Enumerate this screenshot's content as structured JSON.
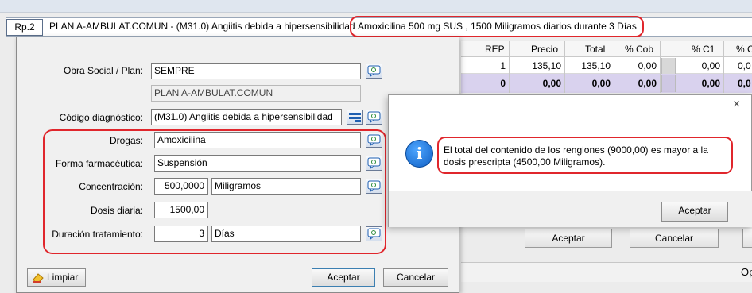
{
  "prescription_bar": {
    "tab": "Rp.2",
    "title": "PLAN A-AMBULAT.COMUN - (M31.0) Angiitis debida a hipersensibilidad",
    "detail": "Amoxicilina 500 mg SUS , 1500 Miligramos diarios durante 3 Días"
  },
  "grid": {
    "headers": [
      "REP",
      "Precio",
      "Total",
      "% Cob",
      "% C1",
      "% C"
    ],
    "rows": [
      [
        "1",
        "135,10",
        "135,10",
        "0,00",
        "0,00",
        "0,0"
      ],
      [
        "0",
        "0,00",
        "0,00",
        "0,00",
        "0,00",
        "0,0"
      ]
    ]
  },
  "form": {
    "obra_social_label": "Obra Social / Plan:",
    "obra_social_value": "SEMPRE",
    "plan_value": "PLAN A-AMBULAT.COMUN",
    "codigo_label": "Código diagnóstico:",
    "codigo_value": "(M31.0) Angiitis debida a hipersensibilidad",
    "drogas_label": "Drogas:",
    "drogas_value": "Amoxicilina",
    "forma_label": "Forma farmacéutica:",
    "forma_value": "Suspensión",
    "concentracion_label": "Concentración:",
    "concentracion_value": "500,0000",
    "concentracion_unit": "Miligramos",
    "dosis_label": "Dosis diaria:",
    "dosis_value": "1500,00",
    "duracion_label": "Duración tratamiento:",
    "duracion_value": "3",
    "duracion_unit": "Días",
    "limpiar": "Limpiar",
    "aceptar": "Aceptar",
    "cancelar": "Cancelar"
  },
  "background_buttons": {
    "aceptar": "Aceptar",
    "cancelar": "Cancelar",
    "op": "Op"
  },
  "message": {
    "text": "El total del contenido de los renglones (9000,00) es mayor a la dosis prescripta (4500,00 Miligramos).",
    "ok": "Aceptar",
    "close": "×",
    "icon": "info-icon"
  }
}
